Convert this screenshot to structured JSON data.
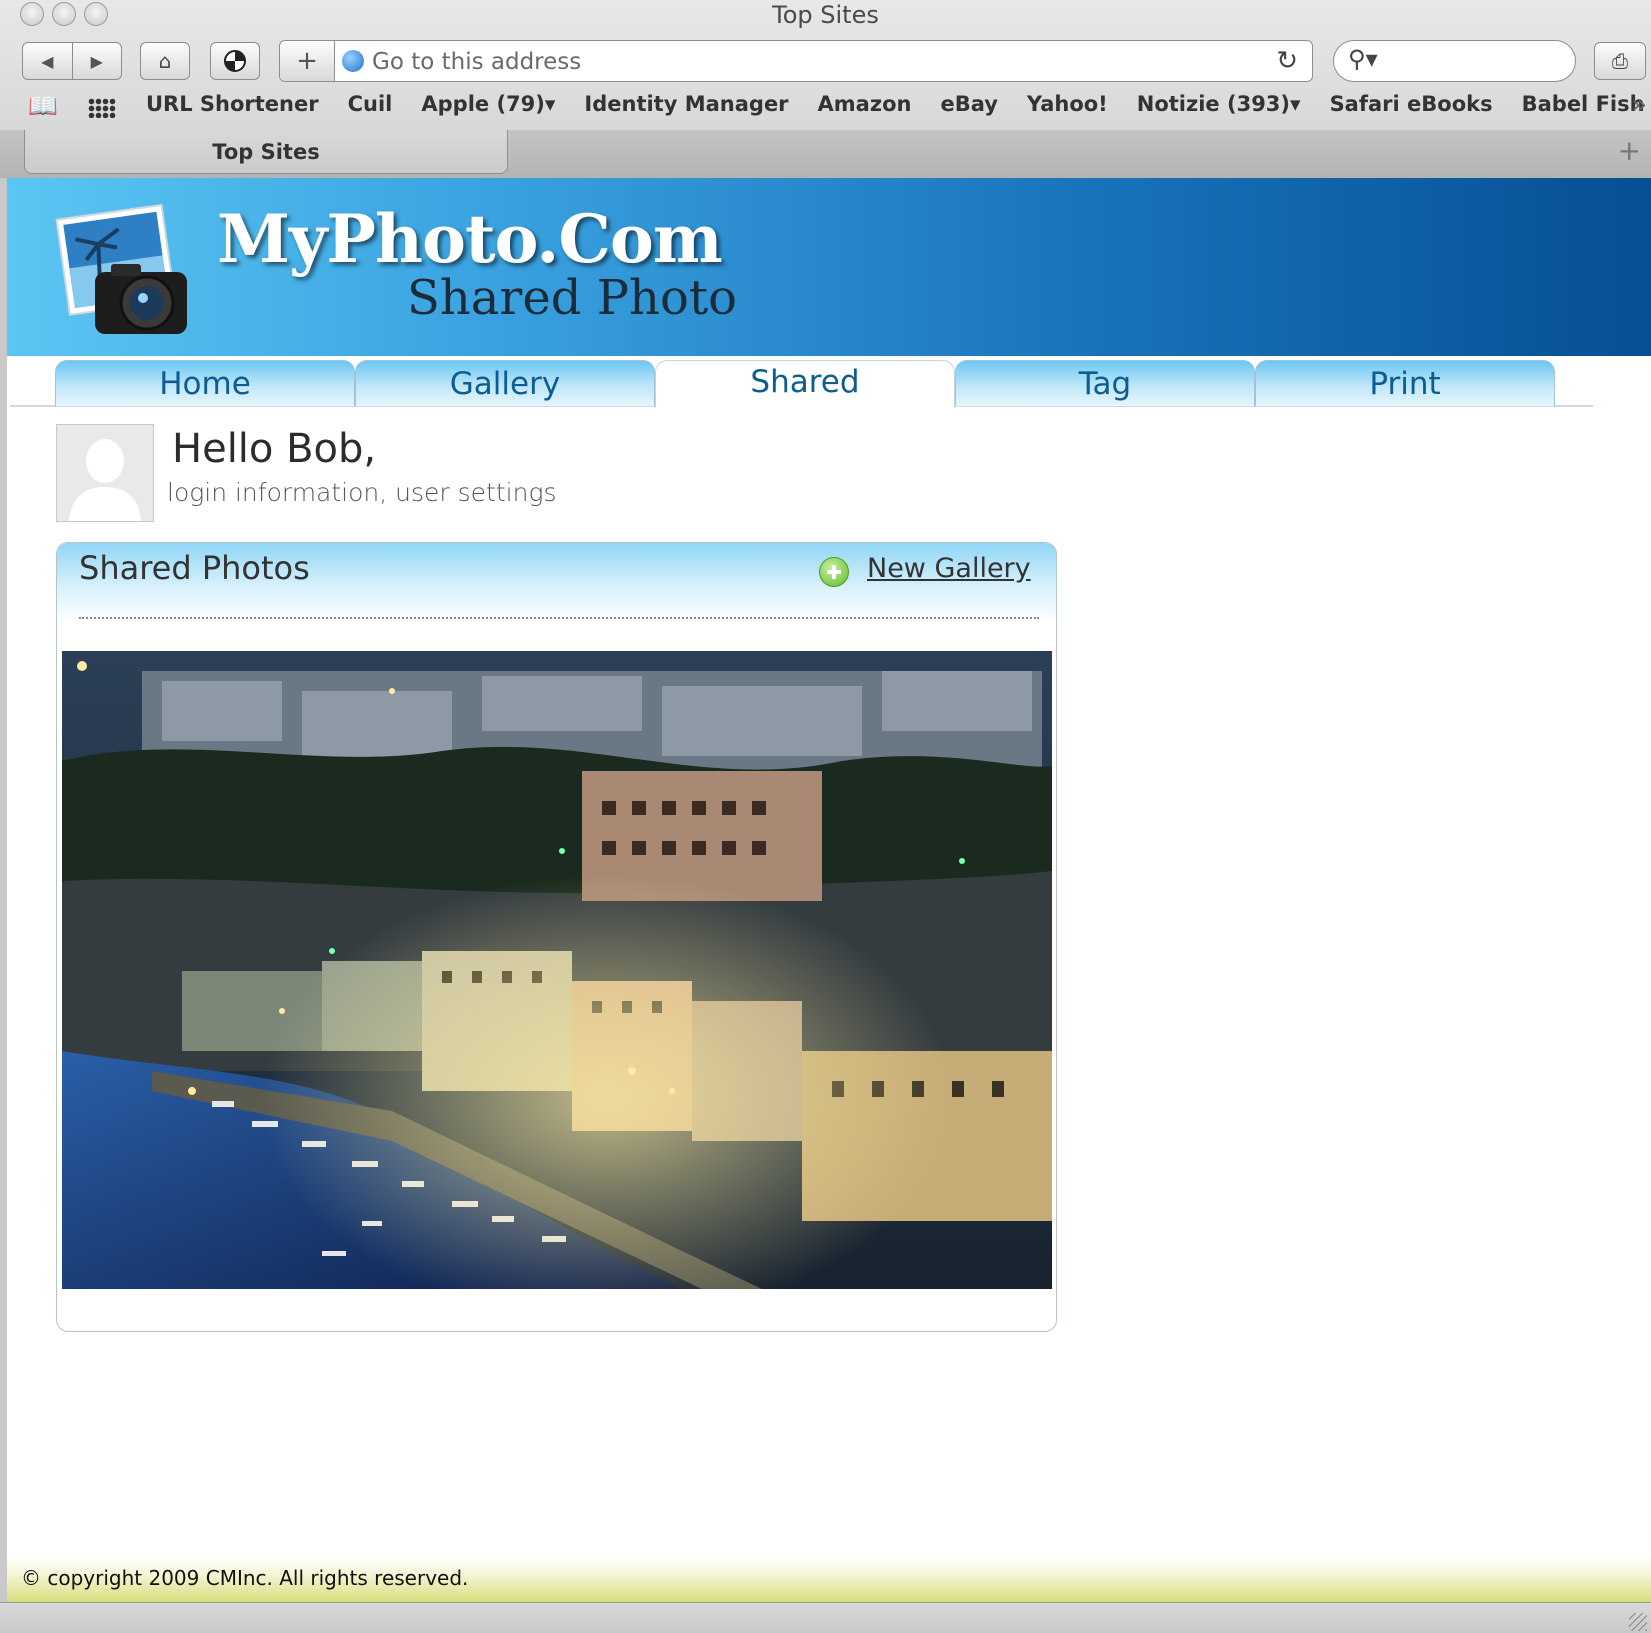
{
  "window": {
    "title": "Top Sites"
  },
  "toolbar": {
    "address_placeholder": "Go to this address",
    "search_placeholder": ""
  },
  "bookmarks": [
    "URL Shortener",
    "Cuil",
    "Apple (79)▾",
    "Identity Manager",
    "Amazon",
    "eBay",
    "Yahoo!",
    "Notizie (393)▾",
    "Safari eBooks",
    "Babel Fish"
  ],
  "browser_tabs": [
    {
      "label": "Top Sites"
    }
  ],
  "site": {
    "title": "MyPhoto.Com",
    "subtitle": "Shared Photo",
    "nav_tabs": [
      {
        "label": "Home"
      },
      {
        "label": "Gallery"
      },
      {
        "label": "Shared",
        "active": true
      },
      {
        "label": "Tag"
      },
      {
        "label": "Print"
      }
    ],
    "greeting": "Hello Bob,",
    "user_links": "login information, user settings",
    "panel": {
      "title": "Shared Photos",
      "new_gallery_label": "New Gallery"
    },
    "footer": "© copyright 2009 CMInc. All rights reserved."
  },
  "colors": {
    "header_start": "#5bc6f3",
    "header_end": "#064f93",
    "tab_text": "#0c5d92",
    "footer_accent": "#d8dd7c"
  },
  "icons": [
    "back-icon",
    "forward-icon",
    "home-icon",
    "bug-icon",
    "add-bookmark-icon",
    "globe-icon",
    "reload-icon",
    "search-icon",
    "print-icon",
    "bookmarks-book-icon",
    "top-sites-grid-icon",
    "more-bookmarks-icon",
    "new-tab-icon",
    "plus-icon",
    "avatar-silhouette-icon"
  ]
}
